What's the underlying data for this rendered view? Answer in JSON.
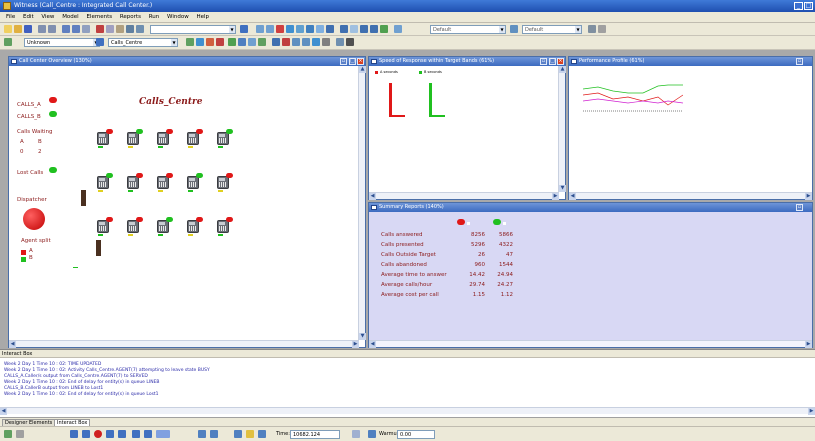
{
  "app": {
    "title": "Witness (Call_Centre : Integrated Call Center.)"
  },
  "menu": [
    "File",
    "Edit",
    "View",
    "Model",
    "Elements",
    "Reports",
    "Run",
    "Window",
    "Help"
  ],
  "toolbar": {
    "combo_default_1": "Default",
    "combo_default_2": "Default",
    "element_combo": "Unknown",
    "model_combo": "Calls_Centre"
  },
  "model_window": {
    "title": "Call Center Overview (130%)",
    "heading": "Calls_Centre",
    "calls_a": "CALLS_A",
    "calls_b": "CALLS_B",
    "calls_waiting": "Calls Waiting",
    "col_a": "A",
    "col_b": "B",
    "waiting_a": "0",
    "waiting_b": "2",
    "lost_calls": "Lost Calls",
    "dispatcher": "Dispatcher",
    "agent_split": "Agent split",
    "split_a": "A",
    "split_b": "B"
  },
  "speed_window": {
    "title": "Speed of Response within Target Bands (61%)",
    "legend_a": "A seconds",
    "legend_b": "B seconds"
  },
  "perf_window": {
    "title": "Performance Profile (61%)"
  },
  "summary_window": {
    "title": "Summary Reports (140%)",
    "rows": [
      {
        "label": "Calls answered",
        "a": "8256",
        "b": "5866"
      },
      {
        "label": "Calls presented",
        "a": "5296",
        "b": "4322"
      },
      {
        "label": "Calls Outside Target",
        "a": "26",
        "b": "47"
      },
      {
        "label": "Calls abandoned",
        "a": "960",
        "b": "1544"
      },
      {
        "label": "Average time to answer",
        "a": "14.42",
        "b": "24.94"
      },
      {
        "label": "Average calls/hour",
        "a": "29.74",
        "b": "24.27"
      },
      {
        "label": "Average cost per call",
        "a": "1.15",
        "b": "1.12"
      }
    ]
  },
  "interact_box": {
    "title": "Interact Box",
    "lines": [
      "Week 2 Day 1 Time 10 : 02: TIME UPDATED",
      "Week 2 Day 1 Time 10 : 02: Activity Calls_Centre.AGENT(7) attempting to leave state BUSY",
      "CALLS_A.Caller/s output from Calls_Centre.AGENT(7) to SERVED",
      "Week 2 Day 1 Time 10 : 02: End of delay for entity(s) in queue LINEB",
      "CALLS_B.CallerB output from LINEB to Lost1",
      "Week 2 Day 1 Time 10 : 02: End of delay for entity(s) in queue Lost1"
    ]
  },
  "tabs": [
    "Designer Elements",
    "Interact Box"
  ],
  "runbar": {
    "time_label": "Time:",
    "time_value": "10682.124",
    "warmup_label": "Warmup:",
    "warmup_value": "0.00"
  }
}
